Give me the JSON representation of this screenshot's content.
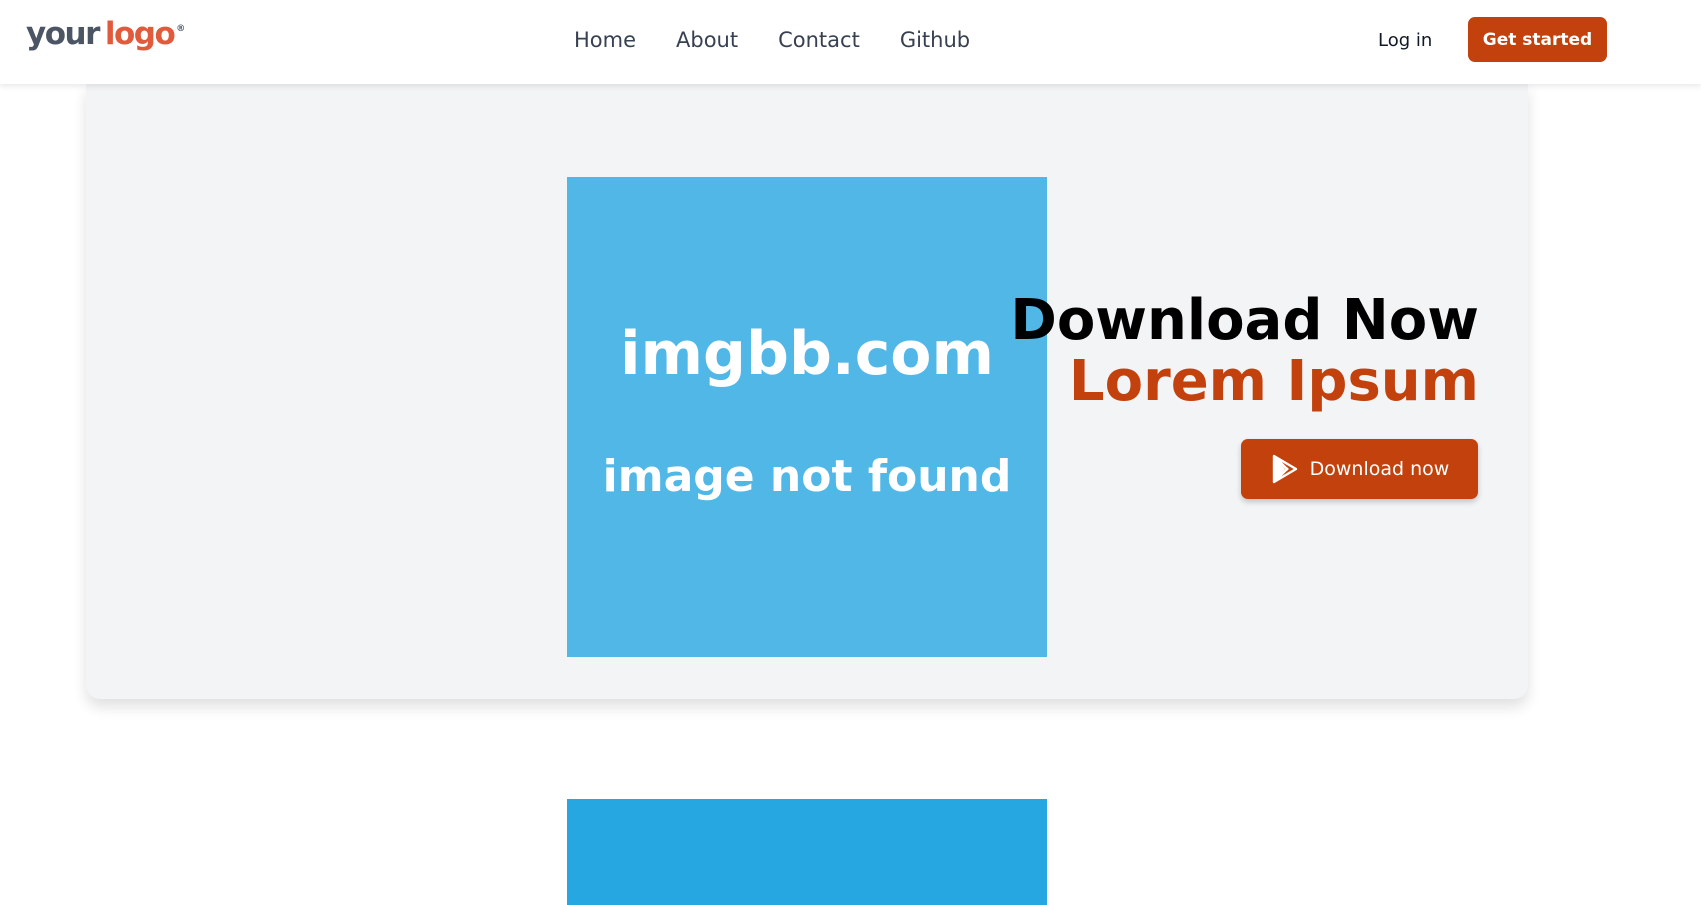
{
  "header": {
    "logo": {
      "word1": "your",
      "word2": "logo",
      "mark": "®"
    },
    "nav": [
      {
        "label": "Home"
      },
      {
        "label": "About"
      },
      {
        "label": "Contact"
      },
      {
        "label": "Github"
      }
    ],
    "login_label": "Log in",
    "cta_label": "Get started"
  },
  "hero": {
    "image": {
      "title": "imgbb.com",
      "subtitle": "image not found"
    },
    "headline_line1": "Download Now",
    "headline_line2": "Lorem Ipsum",
    "button_label": "Download now",
    "button_icon": "play-store-icon"
  },
  "colors": {
    "accent": "#c2410c",
    "logo_accent": "#e05a3c",
    "card_background": "#f3f4f6",
    "image_placeholder": "#51b7e7",
    "image_placeholder_2": "#26a7e1"
  }
}
